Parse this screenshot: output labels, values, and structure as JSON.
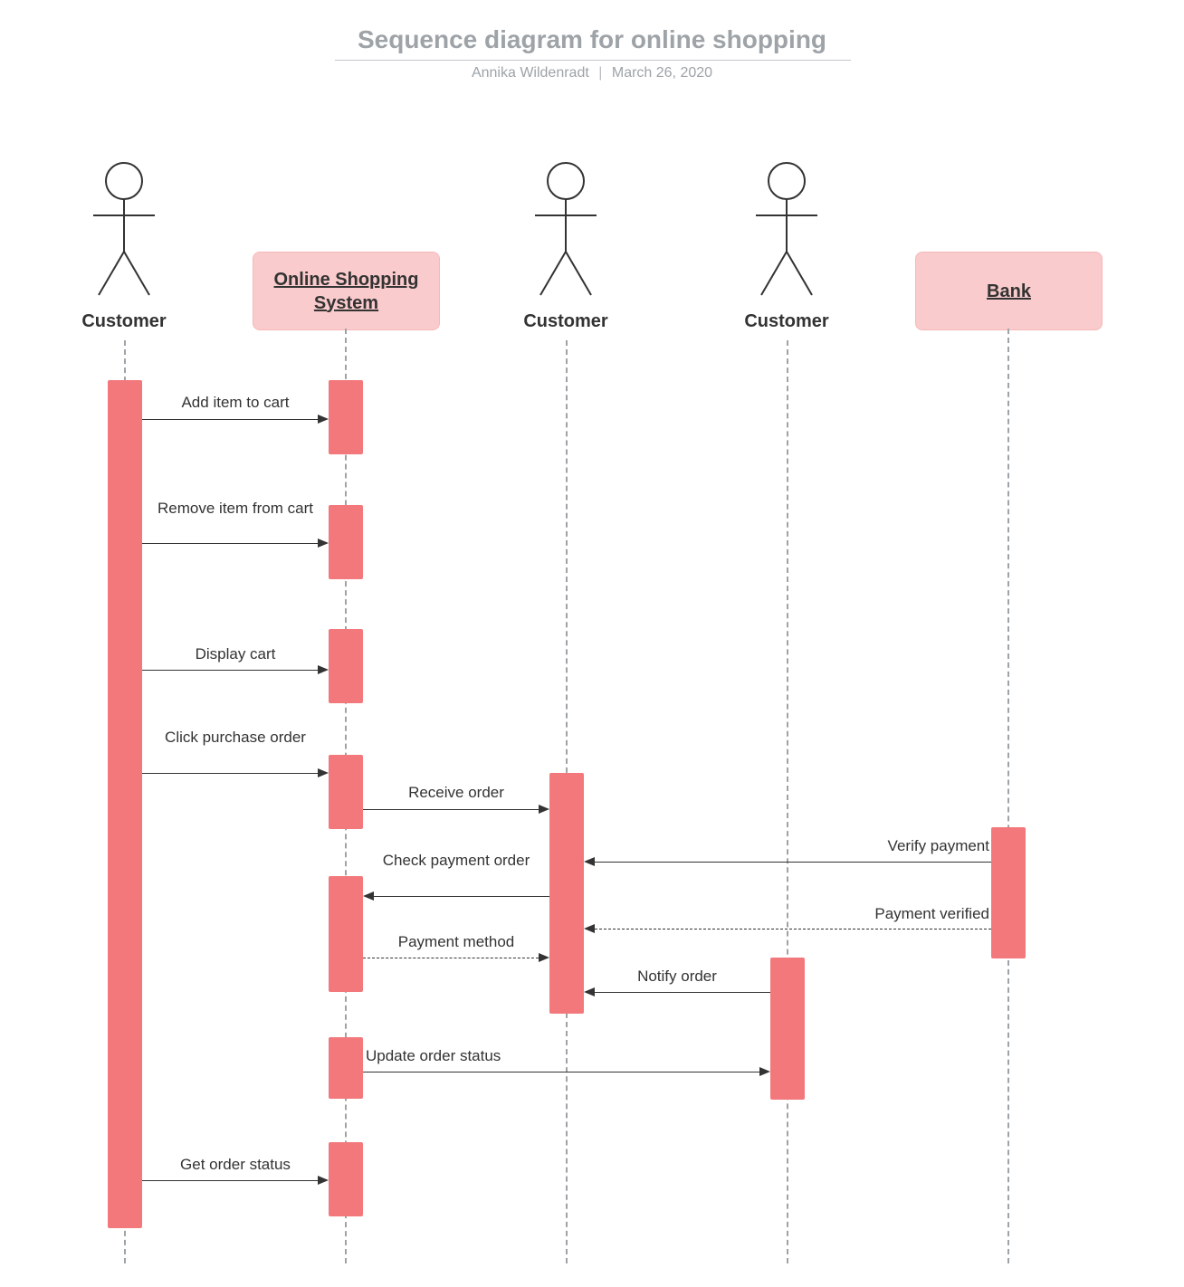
{
  "title": "Sequence diagram for online shopping",
  "author": "Annika Wildenradt",
  "date": "March 26, 2020",
  "participants": [
    {
      "id": "customer1",
      "kind": "actor",
      "label": "Customer"
    },
    {
      "id": "system",
      "kind": "box",
      "label": "Online Shopping System"
    },
    {
      "id": "customer2",
      "kind": "actor",
      "label": "Customer"
    },
    {
      "id": "customer3",
      "kind": "actor",
      "label": "Customer"
    },
    {
      "id": "bank",
      "kind": "box",
      "label": "Bank"
    }
  ],
  "messages": [
    {
      "from": "customer1",
      "to": "system",
      "label": "Add item to cart",
      "style": "solid"
    },
    {
      "from": "customer1",
      "to": "system",
      "label": "Remove item from cart",
      "style": "solid"
    },
    {
      "from": "customer1",
      "to": "system",
      "label": "Display cart",
      "style": "solid"
    },
    {
      "from": "customer1",
      "to": "system",
      "label": "Click purchase order",
      "style": "solid"
    },
    {
      "from": "system",
      "to": "customer2",
      "label": "Receive order",
      "style": "solid"
    },
    {
      "from": "bank",
      "to": "customer2",
      "label": "Verify payment",
      "style": "solid"
    },
    {
      "from": "customer2",
      "to": "system",
      "label": "Check payment order",
      "style": "solid"
    },
    {
      "from": "bank",
      "to": "customer2",
      "label": "Payment verified",
      "style": "dashed"
    },
    {
      "from": "system",
      "to": "customer2",
      "label": "Payment method",
      "style": "dashed"
    },
    {
      "from": "customer3",
      "to": "customer2",
      "label": "Notify order",
      "style": "solid"
    },
    {
      "from": "system",
      "to": "customer3",
      "label": "Update order status",
      "style": "solid"
    },
    {
      "from": "customer1",
      "to": "system",
      "label": "Get order status",
      "style": "solid"
    }
  ],
  "colors": {
    "pinkFill": "#FACBCC",
    "pinkBorder": "#F7B7B9",
    "activation": "#F2787B",
    "grey": "#9EA3A8"
  }
}
